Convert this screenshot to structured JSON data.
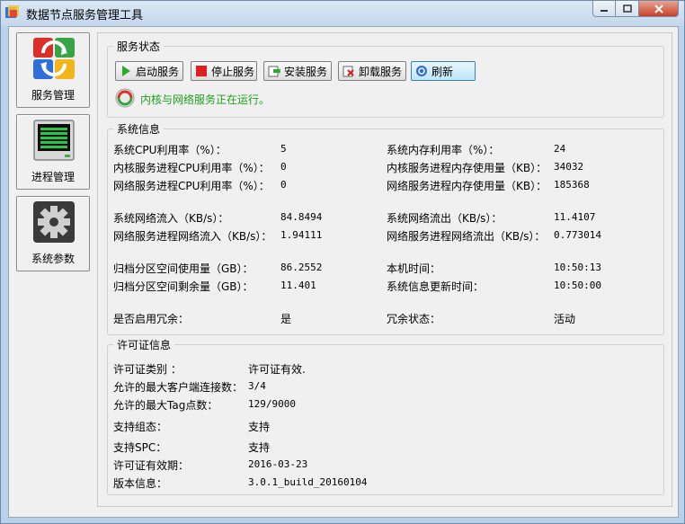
{
  "window": {
    "title": "数据节点服务管理工具"
  },
  "nav": [
    {
      "label": "服务管理"
    },
    {
      "label": "进程管理"
    },
    {
      "label": "系统参数"
    }
  ],
  "service": {
    "caption": "服务状态",
    "buttons": {
      "start": "启动服务",
      "stop": "停止服务",
      "install": "安装服务",
      "uninstall": "卸载服务",
      "refresh": "刷新"
    },
    "status_text": "内核与网络服务正在运行。"
  },
  "sysinfo": {
    "caption": "系统信息",
    "cpu_label": "系统CPU利用率（%）：",
    "cpu_value": "5",
    "mem_label": "系统内存利用率（%）：",
    "mem_value": "24",
    "kernel_cpu_label": "内核服务进程CPU利用率（%）：",
    "kernel_cpu_value": "0",
    "kernel_mem_label": "内核服务进程内存使用量（KB）：",
    "kernel_mem_value": "34032",
    "net_cpu_label": "网络服务进程CPU利用率（%）：",
    "net_cpu_value": "0",
    "net_mem_label": "网络服务进程内存使用量（KB）：",
    "net_mem_value": "185368",
    "net_in_label": "系统网络流入（KB/s）：",
    "net_in_value": "84.8494",
    "net_out_label": "系统网络流出（KB/s）：",
    "net_out_value": "11.4107",
    "proc_in_label": "网络服务进程网络流入（KB/s）：",
    "proc_in_value": "1.94111",
    "proc_out_label": "网络服务进程网络流出（KB/s）：",
    "proc_out_value": "0.773014",
    "archive_used_label": "归档分区空间使用量（GB）：",
    "archive_used_value": "86.2552",
    "local_time_label": "本机时间：",
    "local_time_value": "10:50:13",
    "archive_free_label": "归档分区空间剩余量（GB）：",
    "archive_free_value": "11.401",
    "update_time_label": "系统信息更新时间：",
    "update_time_value": "10:50:00",
    "redundancy_label": "是否启用冗余：",
    "redundancy_value": "是",
    "redundancy_state_label": "冗余状态：",
    "redundancy_state_value": "活动"
  },
  "license": {
    "caption": "许可证信息",
    "type_label": "许可证类别 ：",
    "type_value": "许可证有效.",
    "clients_label": "允许的最大客户端连接数：",
    "clients_value": "3/4",
    "tags_label": "允许的最大Tag点数：",
    "tags_value": "129/9000",
    "config_label": "支持组态：",
    "config_value": "支持",
    "spc_label": "支持SPC：",
    "spc_value": "支持",
    "expiry_label": "许可证有效期：",
    "expiry_value": "2016-03-23",
    "version_label": "版本信息：",
    "version_value": "3.0.1_build_20160104"
  },
  "colors": {
    "status_green": "#1e9e1e",
    "window_frame": "#b9d1ea",
    "selected_button": "#bee6fd"
  }
}
